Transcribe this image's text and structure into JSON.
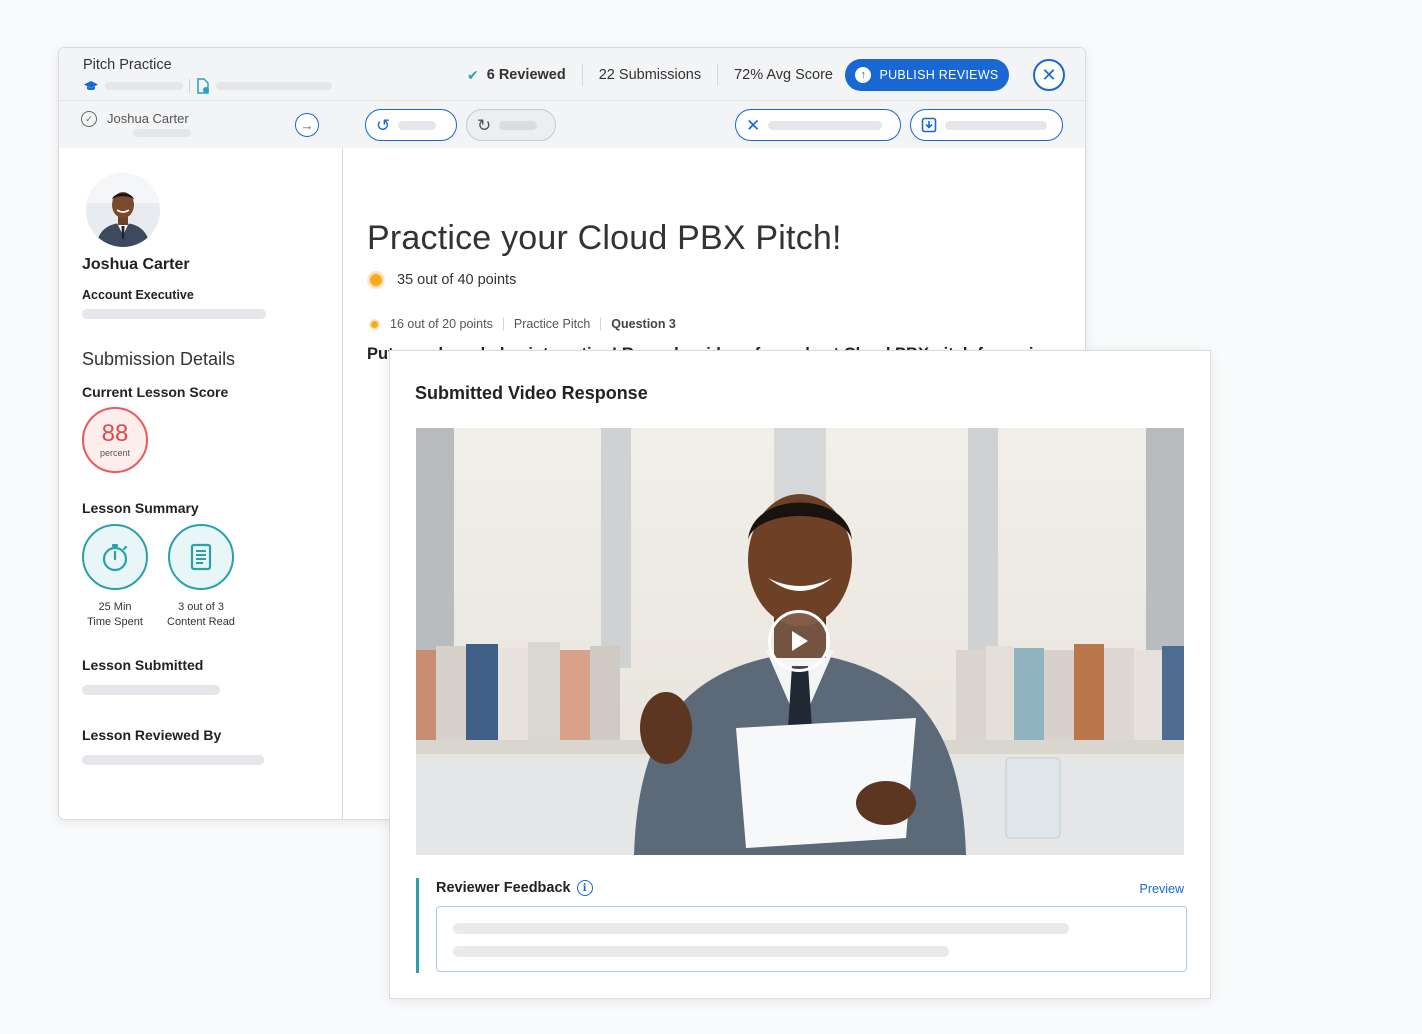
{
  "header": {
    "app_title": "Pitch Practice",
    "reviewed": "6 Reviewed",
    "submissions": "22 Submissions",
    "avg_score": "72% Avg Score",
    "publish_label": "PUBLISH REVIEWS",
    "close_glyph": "✕"
  },
  "student_bar": {
    "name": "Joshua Carter",
    "next_glyph": "→"
  },
  "profile": {
    "name": "Joshua Carter",
    "role": "Account Executive"
  },
  "submission": {
    "section_title": "Submission Details",
    "score_label": "Current Lesson Score",
    "score_value": "88",
    "score_unit": "percent",
    "summary_label": "Lesson Summary",
    "time_value": "25 Min",
    "time_label": "Time Spent",
    "content_value": "3 out of 3",
    "content_label": "Content Read",
    "submitted_label": "Lesson Submitted",
    "reviewed_by_label": "Lesson Reviewed By"
  },
  "lesson": {
    "title": "Practice your Cloud PBX Pitch!",
    "total_points": "35 out of 40 points",
    "question_points": "16 out of 20 points",
    "category": "Practice Pitch",
    "question": "Question 3",
    "prompt": "Put your knowledge into action! Record a video of your best Cloud PBX pitch for review."
  },
  "video": {
    "title": "Submitted Video Response",
    "feedback_label": "Reviewer Feedback",
    "preview_label": "Preview"
  },
  "icons": {
    "check": "check-icon",
    "upload": "upload-icon",
    "close": "close-icon",
    "undo": "undo-icon",
    "redo": "redo-icon",
    "reject": "x-icon",
    "download": "download-icon",
    "stopwatch": "stopwatch-icon",
    "document": "document-icon",
    "play": "play-icon",
    "info": "info-icon"
  },
  "colors": {
    "primary": "#1967d2",
    "teal": "#2aa1a8",
    "score_red": "#e24848",
    "points_orange": "#f7a921"
  }
}
